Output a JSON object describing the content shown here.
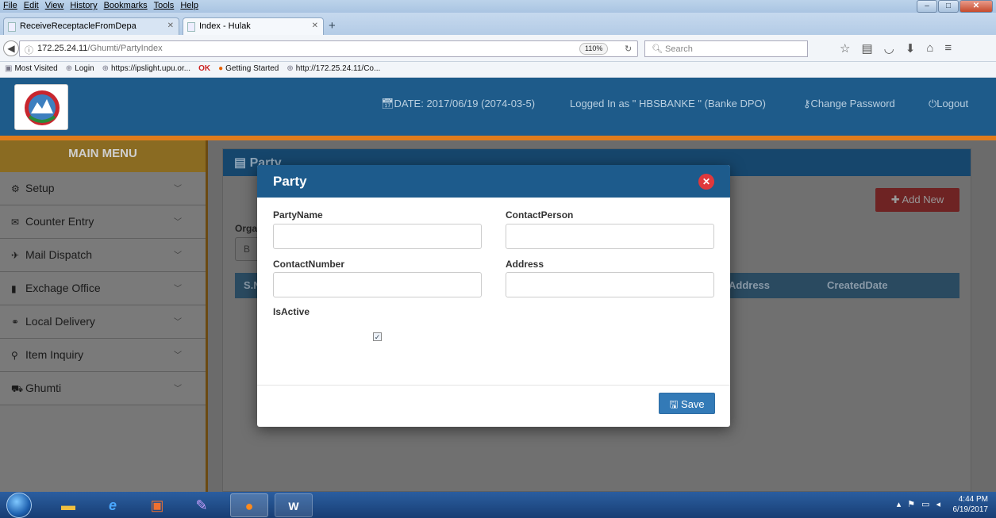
{
  "browser": {
    "menu": [
      "File",
      "Edit",
      "View",
      "History",
      "Bookmarks",
      "Tools",
      "Help"
    ],
    "tabs": [
      {
        "title": "ReceiveReceptacleFromDepa"
      },
      {
        "title": "Index - Hulak"
      }
    ],
    "url_host": "172.25.24.11",
    "url_path": "/Ghumti/PartyIndex",
    "zoom": "110%",
    "search_placeholder": "Search",
    "bookmarks": [
      "Most Visited",
      "Login",
      "https://ipslight.upu.or...",
      "Getting Started",
      "http://172.25.24.11/Co..."
    ]
  },
  "header": {
    "date": "DATE: 2017/06/19 (2074-03-5)",
    "logged_in": "Logged In as \" HBSBANKE \" (Banke DPO)",
    "change_password": "Change Password",
    "logout": "Logout"
  },
  "sidebar": {
    "title": "MAIN MENU",
    "items": [
      {
        "label": "Setup",
        "icon": "cogs-icon"
      },
      {
        "label": "Counter Entry",
        "icon": "envelope-icon"
      },
      {
        "label": "Mail Dispatch",
        "icon": "plane-icon"
      },
      {
        "label": "Exchage Office",
        "icon": "briefcase-icon"
      },
      {
        "label": "Local Delivery",
        "icon": "bicycle-icon"
      },
      {
        "label": "Item Inquiry",
        "icon": "search-icon"
      },
      {
        "label": "Ghumti",
        "icon": "car-icon"
      }
    ]
  },
  "main": {
    "panel_title": "Party",
    "add_new": "Add New",
    "org_label": "Orga",
    "org_value": "B",
    "table_headers": [
      "S.N",
      "Address",
      "CreatedDate"
    ]
  },
  "modal": {
    "title": "Party",
    "fields": {
      "party_name": {
        "label": "PartyName",
        "value": ""
      },
      "contact_person": {
        "label": "ContactPerson",
        "value": ""
      },
      "contact_number": {
        "label": "ContactNumber",
        "value": ""
      },
      "address": {
        "label": "Address",
        "value": ""
      },
      "is_active": {
        "label": "IsActive",
        "checked": true
      }
    },
    "save": "Save"
  },
  "taskbar": {
    "time": "4:44 PM",
    "date": "6/19/2017"
  }
}
